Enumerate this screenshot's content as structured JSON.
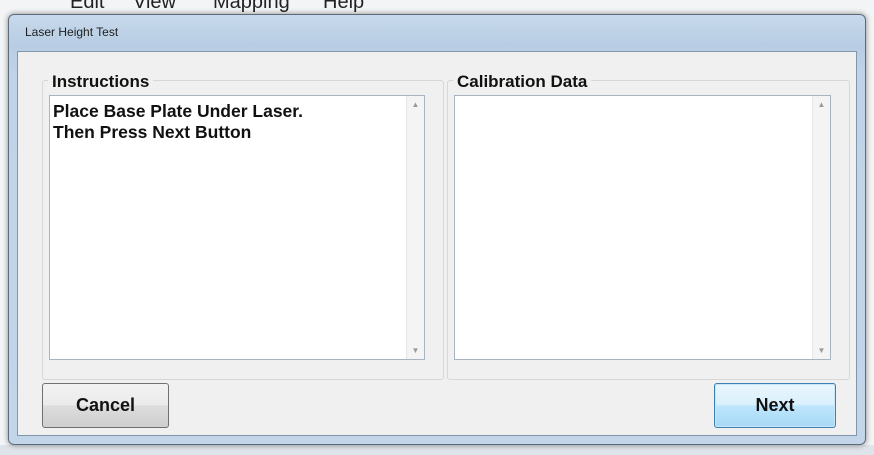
{
  "background_app": {
    "menu": [
      "Edit",
      "View",
      "Mapping",
      "Help"
    ]
  },
  "dialog": {
    "title": "Laser Height Test",
    "instructions": {
      "label": "Instructions",
      "lines": [
        "Place Base Plate Under Laser.",
        "Then Press Next Button"
      ]
    },
    "calibration": {
      "label": "Calibration Data",
      "text": ""
    },
    "buttons": {
      "cancel": "Cancel",
      "next": "Next"
    }
  },
  "icons": {
    "scroll_up": "scroll-up-arrow-icon",
    "scroll_down": "scroll-down-arrow-icon"
  },
  "colors": {
    "title_bar": "#b8cde3",
    "client_bg": "#f0f0f0",
    "next_button": "#bee6fd"
  }
}
